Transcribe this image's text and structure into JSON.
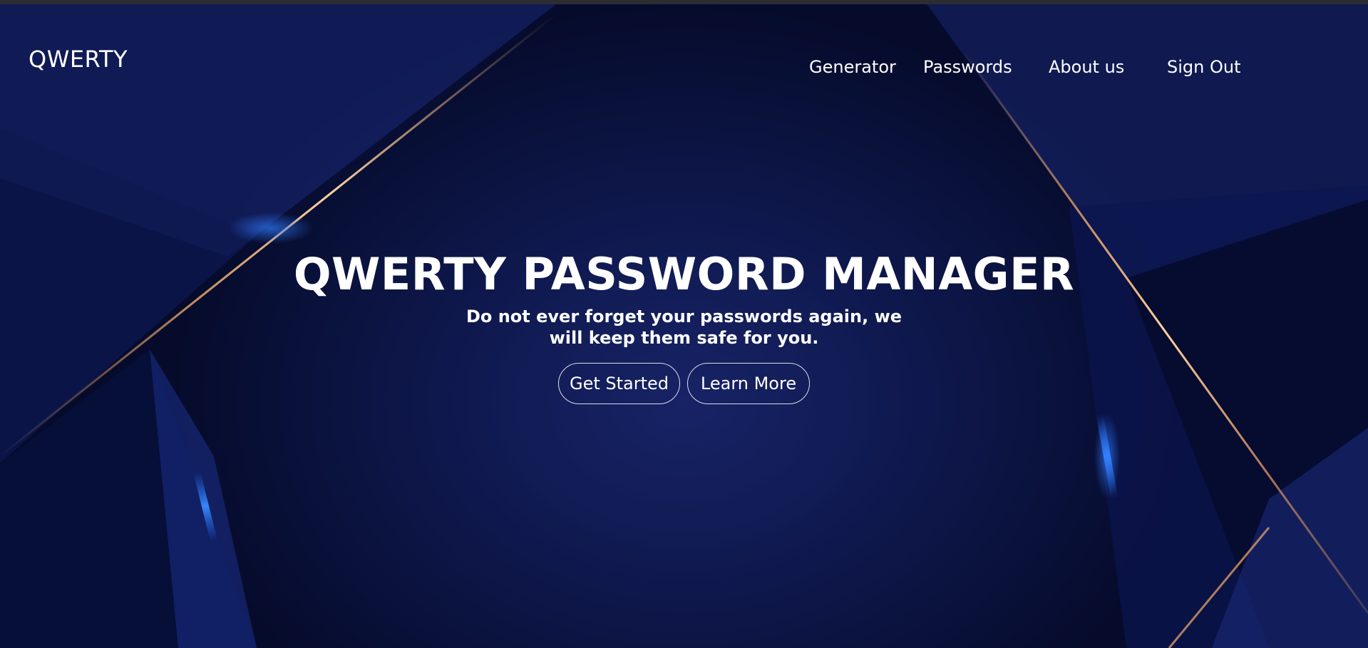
{
  "app": {
    "brand": "QWERTY"
  },
  "nav": {
    "items": [
      {
        "label": "Generator"
      },
      {
        "label": "Passwords"
      },
      {
        "label": "About us"
      },
      {
        "label": "Sign Out"
      }
    ]
  },
  "hero": {
    "title": "QWERTY PASSWORD MANAGER",
    "subtitle": "Do not ever forget your passwords again, we will keep them safe for you.",
    "buttons": {
      "get_started": "Get Started",
      "learn_more": "Learn More"
    }
  },
  "colors": {
    "background_dark": "#060b2b",
    "background_mid": "#111b54",
    "accent_blue": "#1f6fff",
    "accent_gold": "#d99a66",
    "text": "#ffffff"
  }
}
